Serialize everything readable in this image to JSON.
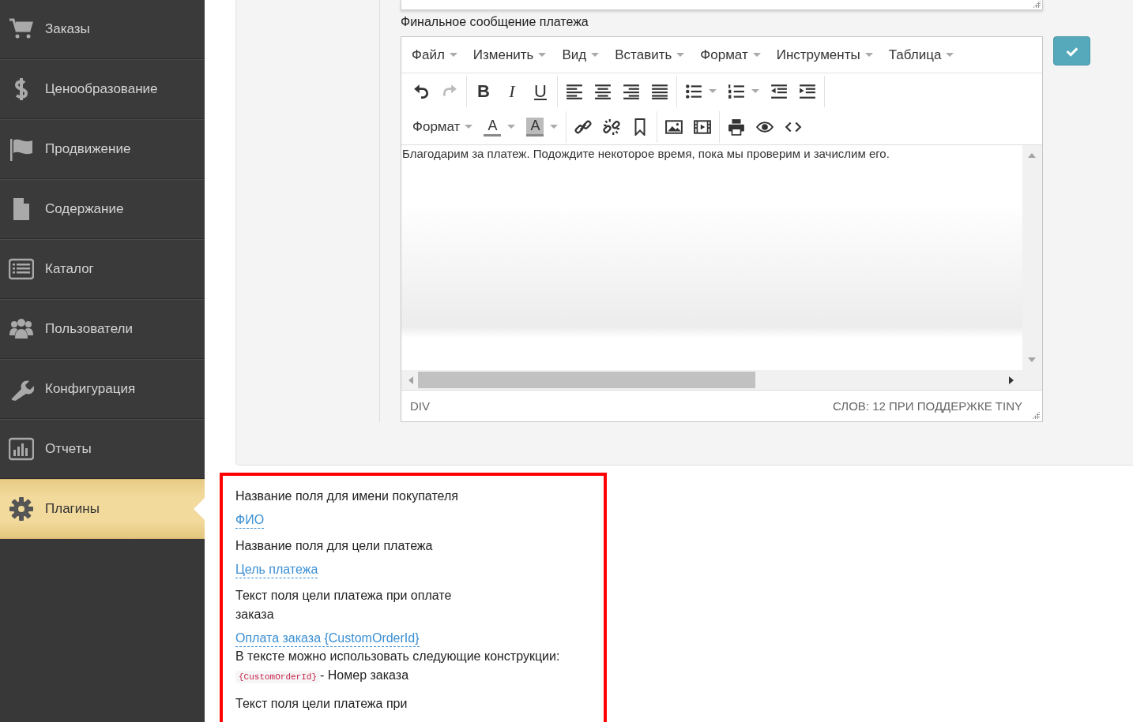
{
  "sidebar": {
    "items": [
      {
        "label": "Заказы",
        "selected": false
      },
      {
        "label": "Ценообразование",
        "selected": false
      },
      {
        "label": "Продвижение",
        "selected": false
      },
      {
        "label": "Содержание",
        "selected": false
      },
      {
        "label": "Каталог",
        "selected": false
      },
      {
        "label": "Пользователи",
        "selected": false
      },
      {
        "label": "Конфигурация",
        "selected": false
      },
      {
        "label": "Отчеты",
        "selected": false
      },
      {
        "label": "Плагины",
        "selected": true
      }
    ]
  },
  "editor": {
    "label": "Финальное сообщение платежа",
    "menu": [
      "Файл",
      "Изменить",
      "Вид",
      "Вставить",
      "Формат",
      "Инструменты",
      "Таблица"
    ],
    "toolbar": {
      "bold": "B",
      "italic": "I",
      "underline": "U",
      "format": "Формат",
      "text_color": "A",
      "background_color": "A"
    },
    "content": "Благодарим за платеж. Подождите некоторое время, пока мы проверим и зачислим его.",
    "status_path": "DIV",
    "status_info": "СЛОВ: 12 ПРИ ПОДДЕРЖКЕ TINY"
  },
  "settings": [
    {
      "label": "Название поля для имени покупателя",
      "value": "ФИО"
    },
    {
      "label": "Название поля для цели платежа",
      "value": "Цель платежа"
    },
    {
      "label": "Текст поля цели платежа при оплате заказа",
      "value": "Оплата заказа {CustomOrderId}",
      "hint": "В тексте можно использовать следующие конструкции:",
      "code": "{CustomOrderId}",
      "code_desc": "- Номер заказа"
    },
    {
      "label": "Текст поля цели платежа при"
    }
  ]
}
